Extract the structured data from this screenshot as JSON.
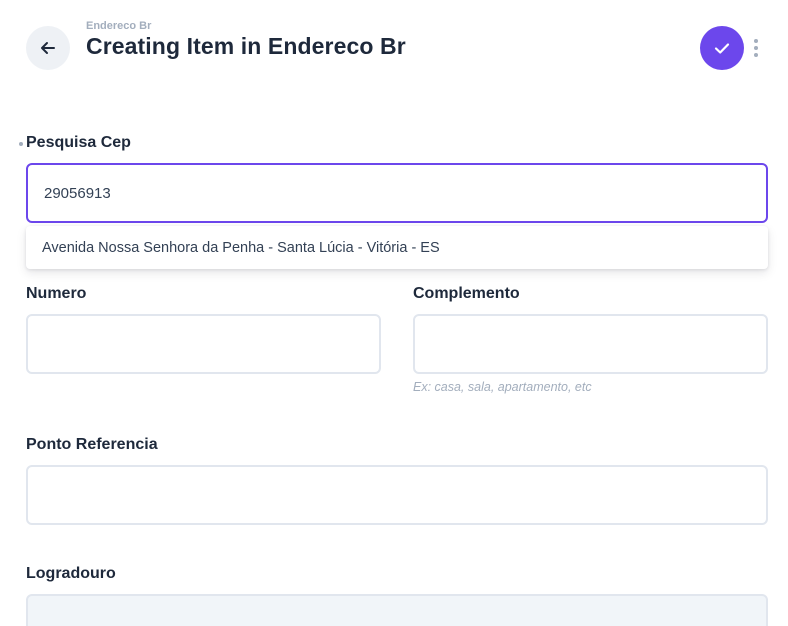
{
  "header": {
    "breadcrumb": "Endereco Br",
    "title": "Creating Item in Endereco Br",
    "accent_color": "#6c47ec"
  },
  "fields": {
    "pesquisa_cep": {
      "label": "Pesquisa Cep",
      "value": "29056913",
      "suggestions": [
        "Avenida Nossa Senhora da Penha - Santa Lúcia - Vitória - ES"
      ]
    },
    "numero": {
      "label": "Numero",
      "value": ""
    },
    "complemento": {
      "label": "Complemento",
      "value": "",
      "hint": "Ex: casa, sala, apartamento, etc"
    },
    "ponto_referencia": {
      "label": "Ponto Referencia",
      "value": ""
    },
    "logradouro": {
      "label": "Logradouro",
      "value": ""
    }
  },
  "icons": {
    "back": "arrow-left-icon",
    "save": "check-icon",
    "more": "more-vertical-icon"
  }
}
